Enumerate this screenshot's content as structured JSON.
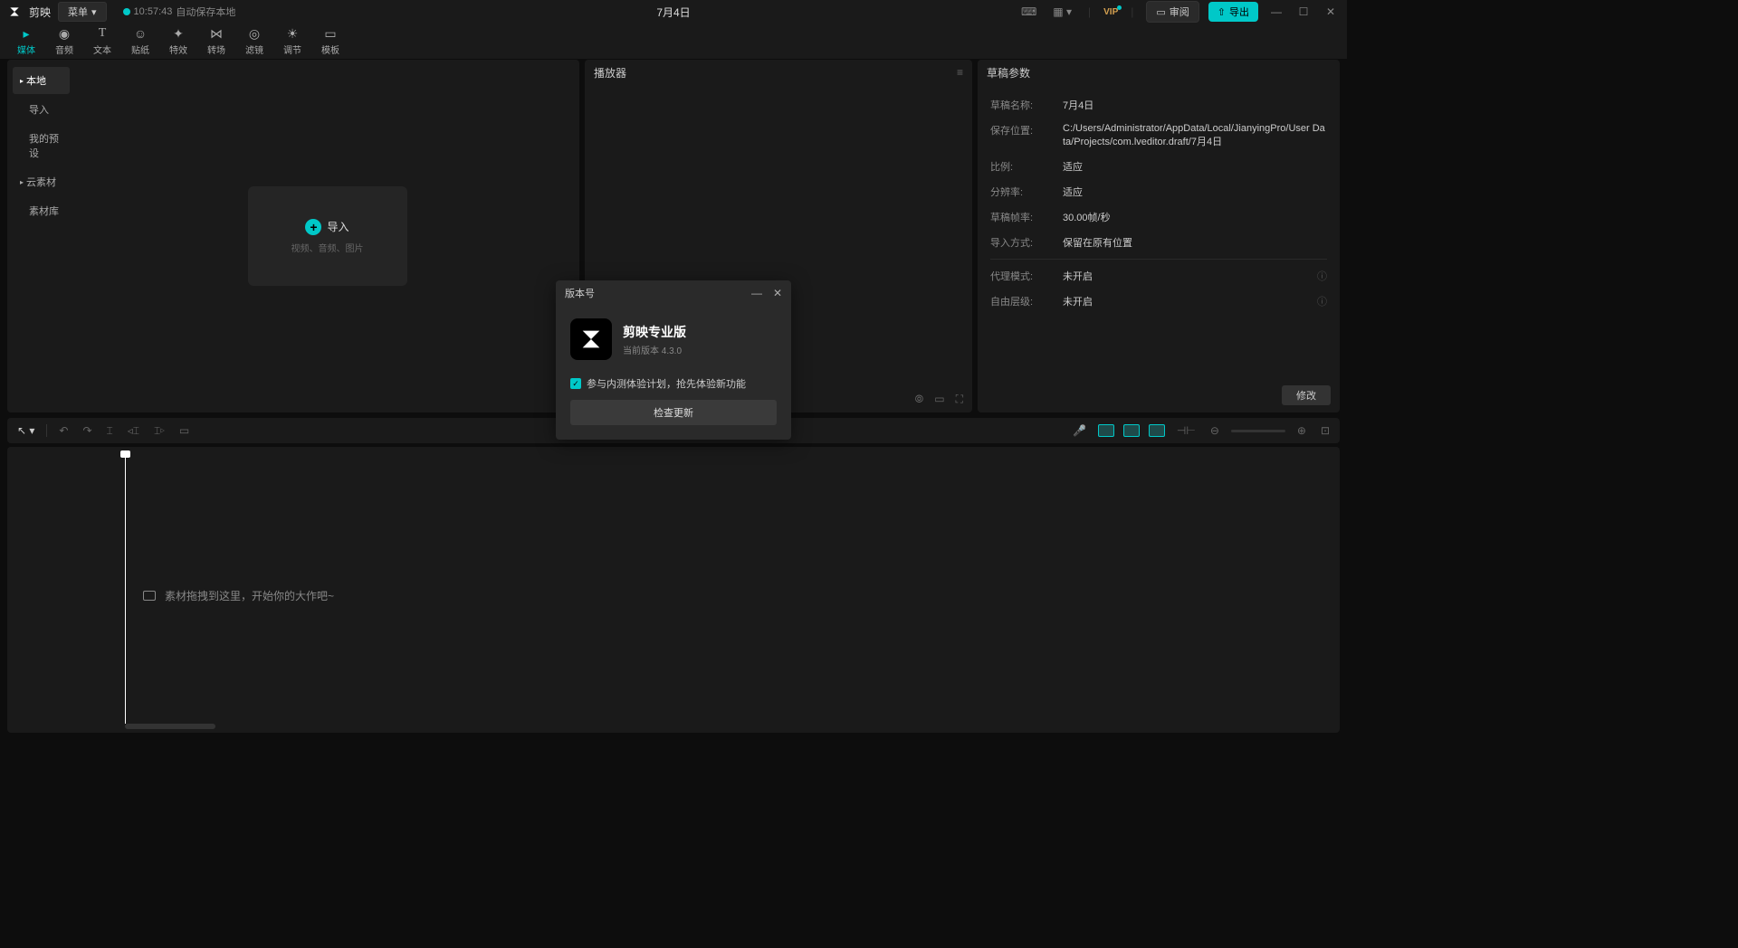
{
  "titlebar": {
    "app_name": "剪映",
    "menu": "菜单",
    "autosave_time": "10:57:43",
    "autosave_text": "自动保存本地",
    "doc_title": "7月4日",
    "vip": "VIP",
    "review": "审阅",
    "export": "导出"
  },
  "top_tabs": [
    {
      "label": "媒体",
      "glyph": "▸"
    },
    {
      "label": "音频",
      "glyph": "◉"
    },
    {
      "label": "文本",
      "glyph": "T"
    },
    {
      "label": "贴纸",
      "glyph": "☺"
    },
    {
      "label": "特效",
      "glyph": "✦"
    },
    {
      "label": "转场",
      "glyph": "⋈"
    },
    {
      "label": "滤镜",
      "glyph": "◎"
    },
    {
      "label": "调节",
      "glyph": "☀"
    },
    {
      "label": "模板",
      "glyph": "▭"
    }
  ],
  "media_sidebar": [
    {
      "label": "本地",
      "caret": "▸",
      "active": true
    },
    {
      "label": "导入"
    },
    {
      "label": "我的预设"
    },
    {
      "label": "云素材",
      "caret": "▸"
    },
    {
      "label": "素材库"
    }
  ],
  "import_box": {
    "title": "导入",
    "sub": "视频、音频、图片"
  },
  "player": {
    "title": "播放器"
  },
  "params": {
    "title": "草稿参数",
    "rows": [
      {
        "label": "草稿名称:",
        "value": "7月4日"
      },
      {
        "label": "保存位置:",
        "value": "C:/Users/Administrator/AppData/Local/JianyingPro/User Data/Projects/com.lveditor.draft/7月4日"
      },
      {
        "label": "比例:",
        "value": "适应"
      },
      {
        "label": "分辨率:",
        "value": "适应"
      },
      {
        "label": "草稿帧率:",
        "value": "30.00帧/秒"
      },
      {
        "label": "导入方式:",
        "value": "保留在原有位置"
      }
    ],
    "rows2": [
      {
        "label": "代理模式:",
        "value": "未开启"
      },
      {
        "label": "自由层级:",
        "value": "未开启"
      }
    ],
    "modify": "修改"
  },
  "timeline": {
    "hint": "素材拖拽到这里，开始你的大作吧~"
  },
  "dialog": {
    "title": "版本号",
    "app_name": "剪映专业版",
    "version_label": "当前版本 4.3.0",
    "beta_text": "参与内测体验计划，抢先体验新功能",
    "check_update": "检查更新"
  }
}
